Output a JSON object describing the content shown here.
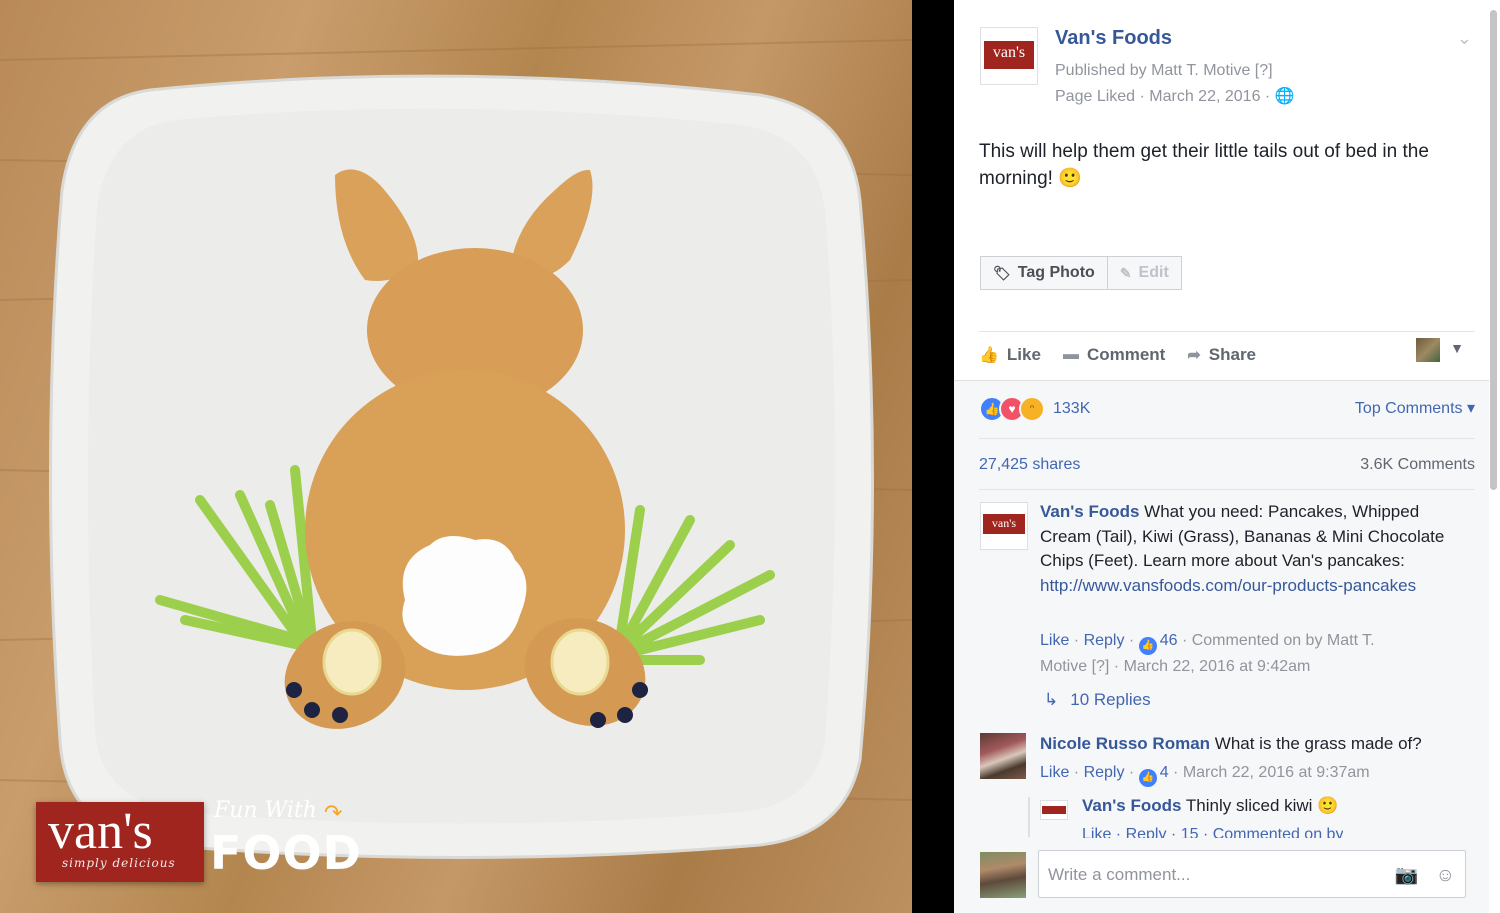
{
  "photo": {
    "brand_word": "van's",
    "brand_tagline": "simply delicious",
    "overlay_small": "Fun With",
    "overlay_big": "FOOD"
  },
  "post": {
    "page_logo_text": "van's",
    "page_name": "Van's Foods",
    "published_by": "Published by Matt T. Motive [?]",
    "meta_line": "Page Liked · March 22, 2016 ·",
    "text": "This will help them get their little tails out of bed in the morning! 🙂",
    "buttons": {
      "tag_photo": "Tag Photo",
      "edit": "Edit"
    },
    "actions": {
      "like": "Like",
      "comment": "Comment",
      "share": "Share"
    },
    "reactions_count": "133K",
    "top_comments": "Top Comments ▾",
    "shares": "27,425 shares",
    "comments_count": "3.6K Comments"
  },
  "comments": [
    {
      "author": "Van's Foods",
      "text": " What you need: Pancakes, Whipped Cream (Tail), Kiwi (Grass), Bananas & Mini Chocolate Chips (Feet). Learn more about Van's pancakes: ",
      "link": "http://www.vansfoods.com/our-products-pancakes",
      "like": "Like",
      "reply": "Reply",
      "likes": "46",
      "meta_line1": " · Commented on by Matt T.",
      "meta_line2": "Motive [?] · March 22, 2016 at 9:42am",
      "replies_label": "10 Replies"
    },
    {
      "author": "Nicole Russo Roman",
      "text": " What is the grass made of?",
      "like": "Like",
      "reply": "Reply",
      "likes": "4",
      "time": " · March 22, 2016 at 9:37am"
    }
  ],
  "reply": {
    "author": "Van's Foods",
    "text": " Thinly sliced kiwi 🙂",
    "cut_meta": "Like · Reply · 15 · Commented on by"
  },
  "composer": {
    "placeholder": "Write a comment..."
  },
  "colors": {
    "link_blue": "#365899",
    "brand_red": "#a0251f",
    "muted": "#90949c"
  }
}
